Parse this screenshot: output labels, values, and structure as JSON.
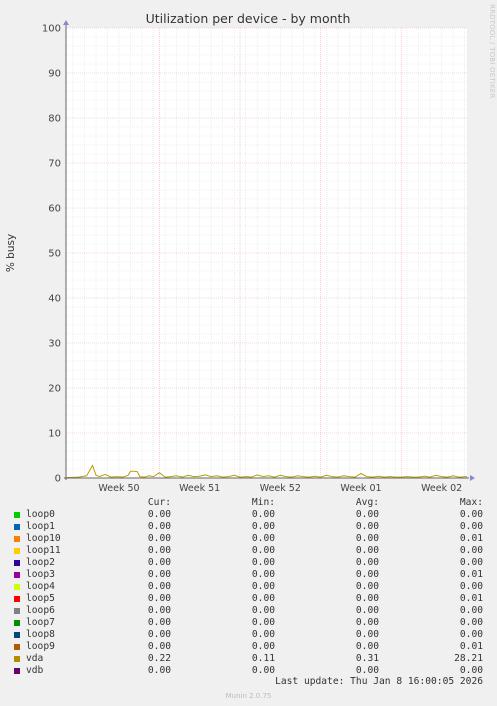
{
  "watermark": "RRDTOOL / TOBI OETIKER",
  "chart_data": {
    "type": "line",
    "title": "Utilization per device - by month",
    "ylabel": "% busy",
    "xlabel": "",
    "ylim": [
      0,
      100
    ],
    "yticks": [
      0,
      10,
      20,
      30,
      40,
      50,
      60,
      70,
      80,
      90,
      100
    ],
    "xticks": [
      {
        "label": "Week 50",
        "at": 2.0
      },
      {
        "label": "Week 51",
        "at": 9.0
      },
      {
        "label": "Week 52",
        "at": 16.0
      },
      {
        "label": "Week 01",
        "at": 23.0
      },
      {
        "label": "Week 02",
        "at": 30.0
      }
    ],
    "xrange": [
      -2.6,
      32.2
    ],
    "grid": true,
    "series": [
      {
        "name": "vda",
        "color": "#b8a000",
        "x": [
          -2.6,
          -1.5,
          -0.8,
          -0.3,
          0.0,
          0.3,
          0.8,
          1.3,
          1.8,
          2.3,
          2.8,
          3.0,
          3.3,
          3.6,
          3.8,
          4.2,
          4.6,
          5.0,
          5.5,
          6.0,
          6.5,
          7.0,
          7.5,
          8.0,
          8.5,
          9.0,
          9.5,
          10.0,
          10.5,
          11.0,
          11.5,
          12.0,
          12.5,
          13.0,
          13.5,
          14.0,
          14.5,
          15.0,
          15.5,
          16.0,
          16.5,
          17.0,
          17.5,
          18.0,
          18.5,
          19.0,
          19.5,
          20.0,
          20.5,
          21.0,
          21.5,
          22.0,
          22.5,
          23.0,
          23.5,
          24.0,
          24.5,
          25.0,
          25.5,
          26.0,
          26.5,
          27.0,
          27.5,
          28.0,
          28.5,
          29.0,
          29.5,
          30.0,
          30.5,
          31.0,
          31.5,
          32.2
        ],
        "y": [
          0.1,
          0.2,
          0.5,
          2.8,
          0.6,
          0.3,
          0.8,
          0.2,
          0.3,
          0.2,
          0.6,
          1.5,
          1.5,
          1.4,
          0.3,
          0.2,
          0.5,
          0.3,
          1.2,
          0.2,
          0.3,
          0.5,
          0.2,
          0.6,
          0.3,
          0.4,
          0.7,
          0.3,
          0.5,
          0.2,
          0.3,
          0.6,
          0.2,
          0.3,
          0.2,
          0.7,
          0.3,
          0.5,
          0.2,
          0.6,
          0.3,
          0.2,
          0.5,
          0.3,
          0.2,
          0.4,
          0.2,
          0.6,
          0.3,
          0.2,
          0.5,
          0.3,
          0.2,
          1.0,
          0.3,
          0.2,
          0.4,
          0.2,
          0.3,
          0.2,
          0.2,
          0.3,
          0.2,
          0.2,
          0.4,
          0.2,
          0.6,
          0.3,
          0.2,
          0.5,
          0.2,
          0.3
        ]
      }
    ]
  },
  "legend": {
    "headers": {
      "cur": "Cur:",
      "min": "Min:",
      "avg": "Avg:",
      "max": "Max:"
    },
    "rows": [
      {
        "name": "loop0",
        "color": "#00cc00",
        "cur": "0.00",
        "min": "0.00",
        "avg": "0.00",
        "max": "0.00"
      },
      {
        "name": "loop1",
        "color": "#0066b3",
        "cur": "0.00",
        "min": "0.00",
        "avg": "0.00",
        "max": "0.00"
      },
      {
        "name": "loop10",
        "color": "#ff8000",
        "cur": "0.00",
        "min": "0.00",
        "avg": "0.00",
        "max": "0.01"
      },
      {
        "name": "loop11",
        "color": "#ffcc00",
        "cur": "0.00",
        "min": "0.00",
        "avg": "0.00",
        "max": "0.00"
      },
      {
        "name": "loop2",
        "color": "#330099",
        "cur": "0.00",
        "min": "0.00",
        "avg": "0.00",
        "max": "0.00"
      },
      {
        "name": "loop3",
        "color": "#990099",
        "cur": "0.00",
        "min": "0.00",
        "avg": "0.00",
        "max": "0.01"
      },
      {
        "name": "loop4",
        "color": "#ccff00",
        "cur": "0.00",
        "min": "0.00",
        "avg": "0.00",
        "max": "0.00"
      },
      {
        "name": "loop5",
        "color": "#ff0000",
        "cur": "0.00",
        "min": "0.00",
        "avg": "0.00",
        "max": "0.01"
      },
      {
        "name": "loop6",
        "color": "#808080",
        "cur": "0.00",
        "min": "0.00",
        "avg": "0.00",
        "max": "0.00"
      },
      {
        "name": "loop7",
        "color": "#008f00",
        "cur": "0.00",
        "min": "0.00",
        "avg": "0.00",
        "max": "0.00"
      },
      {
        "name": "loop8",
        "color": "#00487d",
        "cur": "0.00",
        "min": "0.00",
        "avg": "0.00",
        "max": "0.00"
      },
      {
        "name": "loop9",
        "color": "#b35a00",
        "cur": "0.00",
        "min": "0.00",
        "avg": "0.00",
        "max": "0.01"
      },
      {
        "name": "vda",
        "color": "#b38f00",
        "cur": "0.22",
        "min": "0.11",
        "avg": "0.31",
        "max": "28.21"
      },
      {
        "name": "vdb",
        "color": "#6b006b",
        "cur": "0.00",
        "min": "0.00",
        "avg": "0.00",
        "max": "0.00"
      }
    ]
  },
  "footer": {
    "last_update": "Last update: Thu Jan  8 16:00:05 2026",
    "version": "Munin 2.0.75"
  }
}
